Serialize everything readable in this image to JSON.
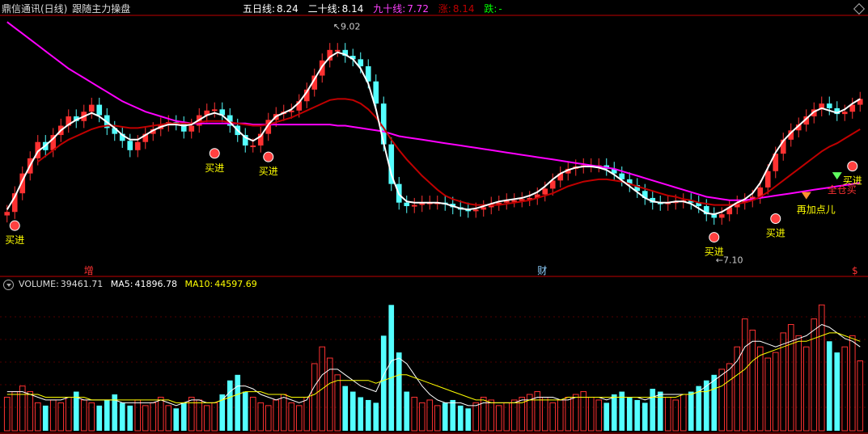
{
  "header": {
    "stock_name": "鼎信通讯(日线)",
    "indicator_name": "跟随主力操盘",
    "ma5_label": "五日线:",
    "ma5_value": "8.24",
    "ma20_label": "二十线:",
    "ma20_value": "8.14",
    "ma90_label": "九十线:",
    "ma90_value": "7.72",
    "up_label": "涨:",
    "up_value": "8.14",
    "down_label": "跌:",
    "down_value": "-"
  },
  "volume_header": {
    "volume_label": "VOLUME:",
    "volume_value": "39461.71",
    "ma5_label": "MA5:",
    "ma5_value": "41896.78",
    "ma10_label": "MA10:",
    "ma10_value": "44597.69"
  },
  "colors": {
    "background": "#000000",
    "up_candle": "#ff3232",
    "down_candle": "#54ffff",
    "ma5_line": "#ffffff",
    "ma20_line": "#c00000",
    "ma90_line": "#ff00ff",
    "trend_green": "#00ff00",
    "signal_text": "#ffff00",
    "divider": "#c00000"
  },
  "chart_data": {
    "type": "candlestick",
    "price_high_label": "9.02",
    "price_low_label": "7.10",
    "closes": [
      7.47,
      7.63,
      7.8,
      7.93,
      8.07,
      8.0,
      8.13,
      8.21,
      8.29,
      8.25,
      8.33,
      8.39,
      8.3,
      8.19,
      8.14,
      8.08,
      8.0,
      8.07,
      8.14,
      8.18,
      8.22,
      8.24,
      8.23,
      8.16,
      8.21,
      8.3,
      8.34,
      8.35,
      8.3,
      8.21,
      8.13,
      8.04,
      8.04,
      8.14,
      8.26,
      8.31,
      8.33,
      8.34,
      8.42,
      8.52,
      8.64,
      8.77,
      8.86,
      8.86,
      8.81,
      8.78,
      8.72,
      8.59,
      8.4,
      8.05,
      7.71,
      7.55,
      7.52,
      7.53,
      7.55,
      7.55,
      7.55,
      7.54,
      7.51,
      7.49,
      7.48,
      7.49,
      7.51,
      7.54,
      7.55,
      7.57,
      7.57,
      7.58,
      7.59,
      7.62,
      7.67,
      7.74,
      7.8,
      7.84,
      7.86,
      7.87,
      7.87,
      7.87,
      7.84,
      7.8,
      7.75,
      7.7,
      7.65,
      7.59,
      7.55,
      7.54,
      7.55,
      7.56,
      7.57,
      7.55,
      7.52,
      7.45,
      7.42,
      7.45,
      7.51,
      7.55,
      7.57,
      7.6,
      7.68,
      7.82,
      7.97,
      8.09,
      8.17,
      8.22,
      8.29,
      8.35,
      8.4,
      8.36,
      8.31,
      8.33,
      8.39,
      8.44
    ],
    "opens": [
      7.44,
      7.47,
      7.63,
      7.8,
      7.93,
      8.07,
      8.0,
      8.13,
      8.21,
      8.29,
      8.25,
      8.33,
      8.39,
      8.3,
      8.19,
      8.14,
      8.08,
      8.0,
      8.07,
      8.14,
      8.18,
      8.22,
      8.24,
      8.23,
      8.16,
      8.21,
      8.3,
      8.34,
      8.35,
      8.3,
      8.21,
      8.13,
      8.04,
      8.04,
      8.14,
      8.26,
      8.31,
      8.33,
      8.34,
      8.42,
      8.52,
      8.64,
      8.77,
      8.86,
      8.86,
      8.81,
      8.78,
      8.72,
      8.59,
      8.4,
      8.05,
      7.71,
      7.55,
      7.52,
      7.53,
      7.55,
      7.55,
      7.55,
      7.54,
      7.51,
      7.49,
      7.48,
      7.49,
      7.51,
      7.54,
      7.55,
      7.57,
      7.57,
      7.58,
      7.59,
      7.62,
      7.67,
      7.74,
      7.8,
      7.84,
      7.86,
      7.87,
      7.87,
      7.87,
      7.84,
      7.8,
      7.75,
      7.7,
      7.65,
      7.59,
      7.55,
      7.54,
      7.55,
      7.56,
      7.57,
      7.55,
      7.52,
      7.45,
      7.42,
      7.45,
      7.51,
      7.55,
      7.57,
      7.6,
      7.68,
      7.82,
      7.97,
      8.09,
      8.17,
      8.22,
      8.29,
      8.35,
      8.4,
      8.36,
      8.31,
      8.33,
      8.39
    ],
    "ma5": [
      7.49,
      7.6,
      7.74,
      7.87,
      7.99,
      8.04,
      8.1,
      8.17,
      8.22,
      8.26,
      8.29,
      8.32,
      8.29,
      8.24,
      8.19,
      8.13,
      8.09,
      8.09,
      8.13,
      8.17,
      8.2,
      8.22,
      8.22,
      8.21,
      8.22,
      8.26,
      8.3,
      8.32,
      8.3,
      8.24,
      8.17,
      8.11,
      8.08,
      8.12,
      8.22,
      8.29,
      8.32,
      8.35,
      8.41,
      8.5,
      8.61,
      8.72,
      8.8,
      8.84,
      8.82,
      8.78,
      8.7,
      8.57,
      8.35,
      8.06,
      7.79,
      7.62,
      7.56,
      7.55,
      7.55,
      7.55,
      7.55,
      7.54,
      7.52,
      7.5,
      7.49,
      7.5,
      7.52,
      7.54,
      7.56,
      7.57,
      7.58,
      7.59,
      7.61,
      7.64,
      7.69,
      7.75,
      7.8,
      7.83,
      7.85,
      7.86,
      7.86,
      7.85,
      7.83,
      7.79,
      7.74,
      7.69,
      7.64,
      7.59,
      7.56,
      7.55,
      7.55,
      7.56,
      7.56,
      7.54,
      7.5,
      7.46,
      7.45,
      7.47,
      7.51,
      7.55,
      7.58,
      7.63,
      7.72,
      7.85,
      7.98,
      8.08,
      8.15,
      8.21,
      8.27,
      8.33,
      8.36,
      8.34,
      8.32,
      8.35,
      8.4,
      8.44
    ],
    "ma20": [
      null,
      null,
      null,
      null,
      7.9,
      7.95,
      8.0,
      8.05,
      8.09,
      8.12,
      8.15,
      8.18,
      8.2,
      8.21,
      8.21,
      8.2,
      8.19,
      8.19,
      8.2,
      8.21,
      8.22,
      8.23,
      8.23,
      8.23,
      8.23,
      8.24,
      8.25,
      8.25,
      8.25,
      8.24,
      8.23,
      8.22,
      8.21,
      8.21,
      8.22,
      8.24,
      8.26,
      8.28,
      8.31,
      8.34,
      8.37,
      8.4,
      8.43,
      8.44,
      8.44,
      8.43,
      8.4,
      8.35,
      8.28,
      8.19,
      8.09,
      8.0,
      7.92,
      7.85,
      7.78,
      7.72,
      7.66,
      7.61,
      7.58,
      7.56,
      7.54,
      7.53,
      7.53,
      7.53,
      7.53,
      7.54,
      7.55,
      7.56,
      7.57,
      7.59,
      7.61,
      7.63,
      7.66,
      7.69,
      7.71,
      7.73,
      7.74,
      7.75,
      7.75,
      7.74,
      7.73,
      7.71,
      7.69,
      7.67,
      7.65,
      7.63,
      7.61,
      7.6,
      7.58,
      7.57,
      7.55,
      7.54,
      7.53,
      7.53,
      7.53,
      7.54,
      7.55,
      7.57,
      7.6,
      7.64,
      7.69,
      7.74,
      7.79,
      7.84,
      7.89,
      7.94,
      7.99,
      8.03,
      8.06,
      8.1,
      8.14,
      8.18
    ],
    "ma90": [
      9.1,
      9.05,
      9.0,
      8.95,
      8.9,
      8.85,
      8.8,
      8.75,
      8.7,
      8.66,
      8.62,
      8.58,
      8.54,
      8.5,
      8.46,
      8.42,
      8.39,
      8.36,
      8.33,
      8.31,
      8.29,
      8.27,
      8.25,
      8.24,
      8.23,
      8.23,
      8.23,
      8.23,
      8.23,
      8.23,
      8.23,
      8.23,
      8.22,
      8.22,
      8.22,
      8.22,
      8.22,
      8.22,
      8.22,
      8.22,
      8.22,
      8.22,
      8.22,
      8.21,
      8.21,
      8.2,
      8.19,
      8.18,
      8.17,
      8.16,
      8.14,
      8.12,
      8.11,
      8.1,
      8.09,
      8.08,
      8.07,
      8.06,
      8.05,
      8.04,
      8.03,
      8.02,
      8.01,
      8.0,
      7.99,
      7.98,
      7.97,
      7.96,
      7.95,
      7.94,
      7.93,
      7.92,
      7.91,
      7.9,
      7.89,
      7.88,
      7.87,
      7.86,
      7.85,
      7.84,
      7.82,
      7.8,
      7.78,
      7.76,
      7.74,
      7.72,
      7.7,
      7.68,
      7.66,
      7.64,
      7.62,
      7.6,
      7.59,
      7.58,
      7.57,
      7.57,
      7.57,
      7.58,
      7.59,
      7.6,
      7.61,
      7.62,
      7.63,
      7.64,
      7.65,
      7.66,
      7.67,
      7.68,
      7.69,
      7.7,
      7.71,
      7.72
    ],
    "volume": [
      12,
      14,
      16,
      14,
      10,
      9,
      11,
      10,
      12,
      14,
      11,
      10,
      9,
      11,
      13,
      10,
      9,
      11,
      9,
      10,
      12,
      9,
      8,
      10,
      12,
      11,
      9,
      10,
      13,
      18,
      20,
      14,
      12,
      10,
      9,
      11,
      13,
      10,
      9,
      12,
      24,
      30,
      26,
      20,
      16,
      14,
      12,
      11,
      10,
      34,
      45,
      28,
      14,
      12,
      10,
      11,
      9,
      10,
      11,
      9,
      8,
      10,
      12,
      11,
      9,
      10,
      11,
      12,
      13,
      14,
      12,
      10,
      11,
      12,
      13,
      14,
      12,
      11,
      10,
      13,
      14,
      12,
      11,
      10,
      15,
      14,
      12,
      11,
      13,
      14,
      16,
      18,
      20,
      22,
      24,
      30,
      40,
      36,
      30,
      26,
      28,
      35,
      38,
      34,
      30,
      40,
      45,
      32,
      28,
      30,
      34,
      25
    ],
    "volume_ma5": [
      14,
      14,
      14,
      13,
      12,
      11,
      11,
      11,
      12,
      12,
      11,
      11,
      11,
      11,
      11,
      10,
      10,
      10,
      10,
      10,
      11,
      10,
      9,
      10,
      11,
      11,
      10,
      10,
      11,
      14,
      16,
      16,
      15,
      13,
      12,
      11,
      12,
      11,
      10,
      11,
      16,
      20,
      22,
      22,
      20,
      18,
      16,
      15,
      14,
      20,
      25,
      26,
      24,
      20,
      16,
      13,
      11,
      10,
      10,
      10,
      9,
      9,
      10,
      10,
      10,
      10,
      10,
      11,
      11,
      12,
      12,
      12,
      11,
      11,
      12,
      12,
      12,
      12,
      11,
      12,
      12,
      12,
      12,
      11,
      12,
      13,
      13,
      13,
      13,
      13,
      14,
      16,
      18,
      20,
      22,
      25,
      30,
      32,
      32,
      31,
      30,
      31,
      32,
      33,
      34,
      36,
      38,
      37,
      35,
      33,
      32,
      30
    ],
    "volume_ma10": [
      13,
      13,
      13,
      13,
      13,
      12,
      12,
      12,
      12,
      12,
      12,
      11,
      11,
      11,
      11,
      11,
      11,
      11,
      11,
      11,
      11,
      11,
      10,
      10,
      10,
      10,
      10,
      10,
      11,
      12,
      13,
      14,
      14,
      14,
      13,
      13,
      13,
      12,
      12,
      12,
      13,
      15,
      17,
      18,
      18,
      18,
      18,
      18,
      17,
      18,
      19,
      20,
      20,
      19,
      18,
      17,
      16,
      15,
      14,
      13,
      12,
      11,
      11,
      10,
      10,
      10,
      10,
      10,
      11,
      11,
      11,
      11,
      11,
      12,
      12,
      12,
      12,
      12,
      12,
      12,
      12,
      12,
      12,
      12,
      12,
      12,
      12,
      12,
      13,
      13,
      14,
      14,
      15,
      16,
      18,
      20,
      22,
      25,
      27,
      28,
      29,
      30,
      31,
      32,
      32,
      33,
      34,
      35,
      35,
      34,
      33,
      32
    ],
    "signals": [
      {
        "index": 1,
        "label": "买进",
        "kind": "buy"
      },
      {
        "index": 27,
        "label": "买进",
        "kind": "buy"
      },
      {
        "index": 34,
        "label": "买进",
        "kind": "buy"
      },
      {
        "index": 92,
        "label": "买进",
        "kind": "buy"
      },
      {
        "index": 100,
        "label": "买进",
        "kind": "buy"
      },
      {
        "index": 104,
        "label": "再加点儿",
        "kind": "add"
      },
      {
        "index": 108,
        "label": "全仓买",
        "kind": "full"
      },
      {
        "index": 110,
        "label": "买进",
        "kind": "buy"
      }
    ],
    "markers": [
      {
        "index": 10,
        "label": "增",
        "color": "#ff3232"
      },
      {
        "index": 69,
        "label": "财",
        "color": "#8fd0ff"
      },
      {
        "index": 135,
        "label": "$",
        "color": "#ff3232"
      }
    ]
  }
}
